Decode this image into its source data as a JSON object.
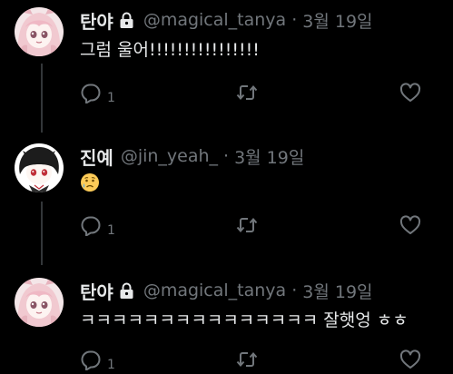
{
  "tweets": [
    {
      "display_name": "탄야",
      "handle": "@magical_tanya",
      "separator": "·",
      "date": "3월 19일",
      "protected": true,
      "text": "그럼 울어!!!!!!!!!!!!!!!!",
      "emoji": null,
      "reply_count": "1",
      "avatar": "avatar-pink-hair-girl"
    },
    {
      "display_name": "진예",
      "handle": "@jin_yeah_",
      "separator": "·",
      "date": "3월 19일",
      "protected": false,
      "text": "",
      "emoji": "crying-face",
      "reply_count": "1",
      "avatar": "avatar-dark-hair-boy"
    },
    {
      "display_name": "탄야",
      "handle": "@magical_tanya",
      "separator": "·",
      "date": "3월 19일",
      "protected": true,
      "text": "ㅋㅋㅋㅋㅋㅋㅋㅋㅋㅋㅋㅋㅋㅋㅋ 잘햇엉 ㅎㅎ",
      "emoji": null,
      "reply_count": "1",
      "avatar": "avatar-pink-hair-girl"
    }
  ],
  "icons": {
    "reply": "reply-icon",
    "retweet": "retweet-icon",
    "like": "heart-icon",
    "lock": "lock-icon"
  },
  "colors": {
    "background": "#000000",
    "primary_text": "#e7e9ea",
    "secondary_text": "#71767b",
    "thread_line": "#333639"
  }
}
